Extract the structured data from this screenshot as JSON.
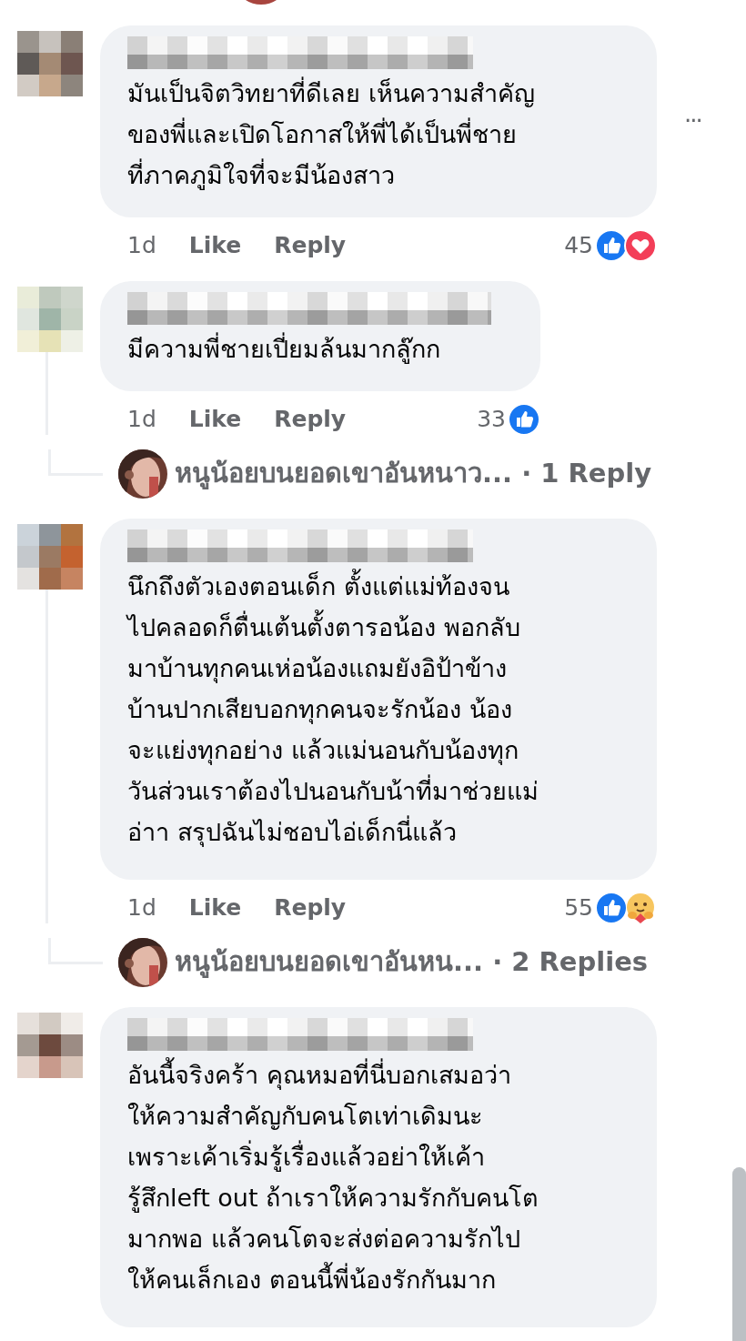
{
  "comments": [
    {
      "lines": [
        "มันเป็นจิตวิทยาที่ดีเลย เห็นความสำคัญ",
        "ของพี่และเปิดโอกาสให้พี่ได้เป็นพี่ชาย",
        "ที่ภาคภูมิใจที่จะมีน้องสาว"
      ],
      "more": "···",
      "time": "1d",
      "like": "Like",
      "reply": "Reply",
      "count": "45",
      "reactions": [
        {
          "kind": "like"
        },
        {
          "kind": "love"
        }
      ]
    },
    {
      "lines": [
        "มีความพี่ชายเปี่ยมล้นมากลู๊กก"
      ],
      "time": "1d",
      "like": "Like",
      "reply": "Reply",
      "count": "33",
      "reactions": [
        {
          "kind": "like"
        }
      ],
      "replies": {
        "name": "หนูน้อยบนยอดเขาอันหนาว...",
        "count": "· 1 Reply"
      }
    },
    {
      "lines": [
        "นึกถึงตัวเองตอนเด็ก ตั้งแต่แม่ท้องจน",
        "ไปคลอดก็ตื่นเต้นตั้งตารอน้อง พอกลับ",
        "มาบ้านทุกคนเห่อน้องแถมยังอิป้าข้าง",
        "บ้านปากเสียบอกทุกคนจะรักน้อง น้อง",
        "จะแย่งทุกอย่าง แล้วแม่นอนกับน้องทุก",
        "วันส่วนเราต้องไปนอนกับน้าที่มาช่วยแม่",
        "อ่าา สรุปฉันไม่ชอบไอ่เด็กนี่แล้ว"
      ],
      "time": "1d",
      "like": "Like",
      "reply": "Reply",
      "count": "55",
      "reactions": [
        {
          "kind": "like"
        },
        {
          "kind": "care"
        }
      ],
      "replies": {
        "name": "หนูน้อยบนยอดเขาอันหน...",
        "count": "· 2 Replies"
      }
    },
    {
      "lines": [
        "อันนี้จริงคร้า คุณหมอที่นี่บอกเสมอว่า",
        "ให้ความสำคัญกับคนโตเท่าเดิมนะ",
        "เพราะเค้าเริ่มรู้เรื่องแล้วอย่าให้เค้า",
        "รู้สึกleft out ถ้าเราให้ความรักกับคนโต",
        "มากพอ แล้วคนโตจะส่งต่อความรักไป",
        "ให้คนเล็กเอง ตอนนี้พี่น้องรักกันมาก"
      ]
    }
  ]
}
